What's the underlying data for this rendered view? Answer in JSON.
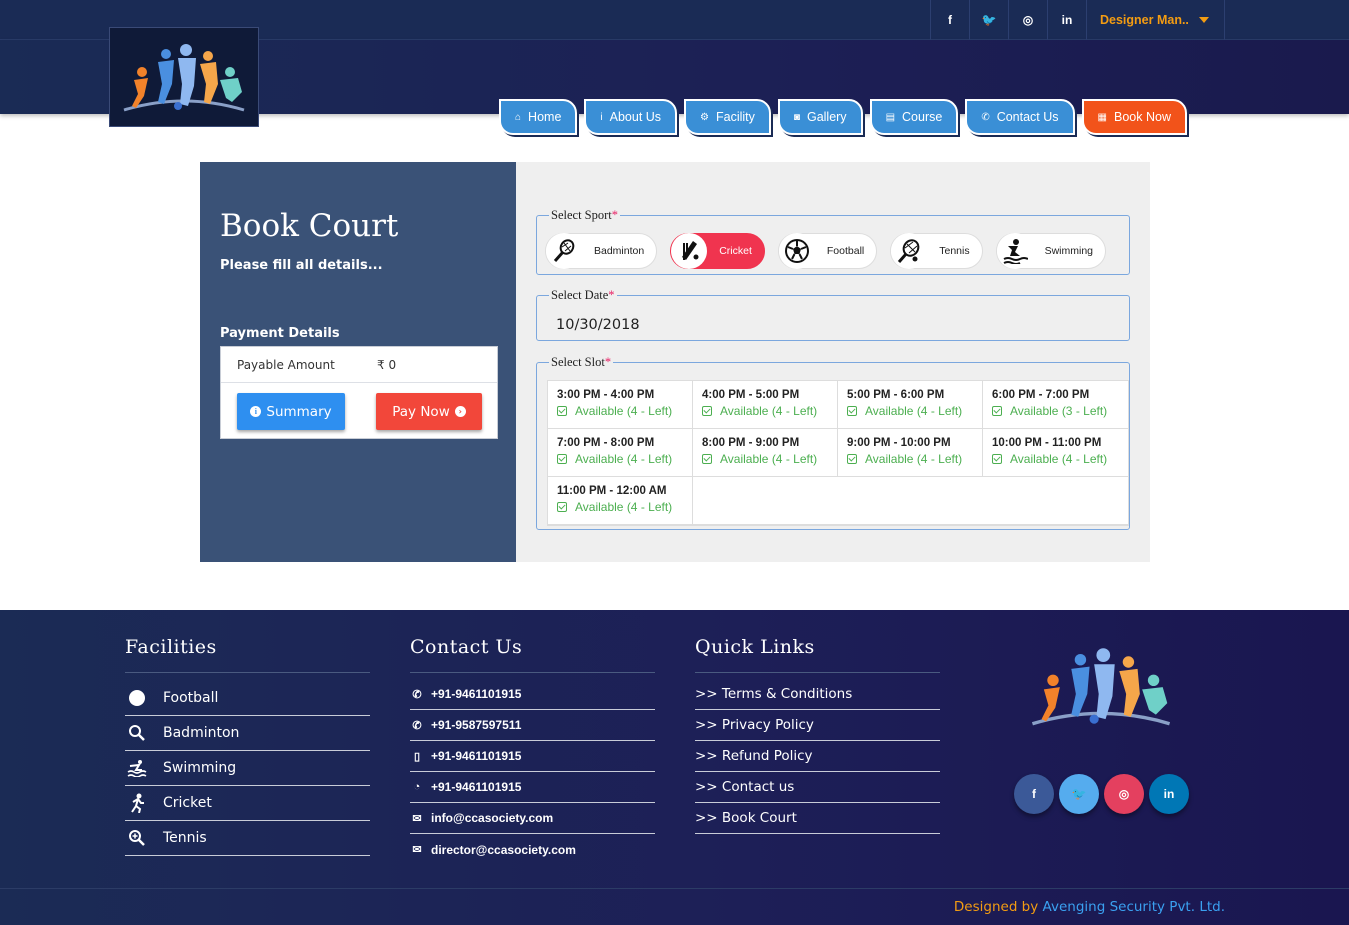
{
  "header": {
    "social": [
      {
        "icon": "facebook-icon",
        "glyph": "f"
      },
      {
        "icon": "twitter-icon",
        "glyph": "🐦"
      },
      {
        "icon": "instagram-icon",
        "glyph": "◎"
      },
      {
        "icon": "linkedin-icon",
        "glyph": "in"
      }
    ],
    "user_menu": "Designer Man..",
    "nav": [
      {
        "label": "Home",
        "icon": "home-icon",
        "glyph": "⌂"
      },
      {
        "label": "About Us",
        "icon": "info-icon",
        "glyph": "i"
      },
      {
        "label": "Facility",
        "icon": "gears-icon",
        "glyph": "⚙"
      },
      {
        "label": "Gallery",
        "icon": "camera-icon",
        "glyph": "◙"
      },
      {
        "label": "Course",
        "icon": "book-icon",
        "glyph": "▤"
      },
      {
        "label": "Contact Us",
        "icon": "phone-icon",
        "glyph": "✆"
      },
      {
        "label": "Book Now",
        "icon": "calendar-icon",
        "glyph": "▦"
      }
    ]
  },
  "booking": {
    "title": "Book Court",
    "subtitle": "Please fill all details...",
    "payment_title": "Payment Details",
    "payable_label": "Payable Amount",
    "payable_value": "₹ 0",
    "summary_label": "Summary",
    "pay_label": "Pay Now",
    "sport_legend": "Select Sport",
    "date_legend": "Select Date",
    "slot_legend": "Select Slot",
    "required_mark": "*",
    "date_value": "10/30/2018",
    "sports": [
      {
        "label": "Badminton",
        "icon": "badminton-racket-icon",
        "active": false
      },
      {
        "label": "Cricket",
        "icon": "cricket-bat-icon",
        "active": true
      },
      {
        "label": "Football",
        "icon": "football-icon",
        "active": false
      },
      {
        "label": "Tennis",
        "icon": "tennis-racket-icon",
        "active": false
      },
      {
        "label": "Swimming",
        "icon": "swimming-icon",
        "active": false
      }
    ],
    "slots": [
      {
        "time": "3:00 PM - 4:00 PM",
        "status": "Available (4 - Left)"
      },
      {
        "time": "4:00 PM - 5:00 PM",
        "status": "Available (4 - Left)"
      },
      {
        "time": "5:00 PM - 6:00 PM",
        "status": "Available (4 - Left)"
      },
      {
        "time": "6:00 PM - 7:00 PM",
        "status": "Available (3 - Left)"
      },
      {
        "time": "7:00 PM - 8:00 PM",
        "status": "Available (4 - Left)"
      },
      {
        "time": "8:00 PM - 9:00 PM",
        "status": "Available (4 - Left)"
      },
      {
        "time": "9:00 PM - 10:00 PM",
        "status": "Available (4 - Left)"
      },
      {
        "time": "10:00 PM - 11:00 PM",
        "status": "Available (4 - Left)"
      },
      {
        "time": "11:00 PM - 12:00 AM",
        "status": "Available (4 - Left)"
      }
    ]
  },
  "footer": {
    "facilities_title": "Facilities",
    "facilities": [
      {
        "label": "Football",
        "icon": "football-icon"
      },
      {
        "label": "Badminton",
        "icon": "search-icon"
      },
      {
        "label": "Swimming",
        "icon": "swimming-icon"
      },
      {
        "label": "Cricket",
        "icon": "running-icon"
      },
      {
        "label": "Tennis",
        "icon": "zoom-icon"
      }
    ],
    "contact_title": "Contact Us",
    "contacts": [
      {
        "text": "+91-9461101915",
        "icon": "phone-icon",
        "glyph": "✆"
      },
      {
        "text": "+91-9587597511",
        "icon": "phone-icon",
        "glyph": "✆"
      },
      {
        "text": "+91-9461101915",
        "icon": "mobile-icon",
        "glyph": "▯"
      },
      {
        "text": "+91-9461101915",
        "icon": "whatsapp-icon",
        "glyph": "◔"
      },
      {
        "text": "info@ccasociety.com",
        "icon": "envelope-icon",
        "glyph": "✉"
      },
      {
        "text": "director@ccasociety.com",
        "icon": "envelope-icon",
        "glyph": "✉"
      }
    ],
    "quicklinks_title": "Quick Links",
    "quicklinks": [
      ">> Terms & Conditions",
      ">> Privacy Policy",
      ">> Refund Policy",
      ">> Contact us",
      ">> Book Court"
    ],
    "social": [
      {
        "icon": "facebook-icon",
        "glyph": "f",
        "color": "#3b5998"
      },
      {
        "icon": "twitter-icon",
        "glyph": "🐦",
        "color": "#55acee"
      },
      {
        "icon": "instagram-icon",
        "glyph": "◎",
        "color": "#e4405f"
      },
      {
        "icon": "linkedin-icon",
        "glyph": "in",
        "color": "#0077b5"
      }
    ],
    "designed_prefix": "Designed by",
    "designed_company": "Avenging Security Pvt. Ltd."
  }
}
